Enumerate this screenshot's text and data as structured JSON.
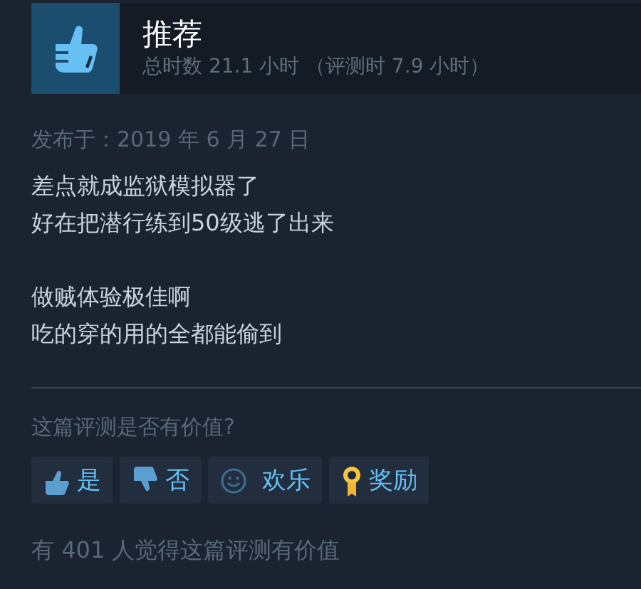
{
  "review": {
    "verdict": "推荐",
    "recommended": true,
    "hours": "总时数 21.1 小时 （评测时 7.9 小时）",
    "posted": "发布于：2019 年 6 月 27 日",
    "paragraphs": [
      [
        "差点就成监狱模拟器了",
        "好在把潜行练到50级逃了出来"
      ],
      [
        "做贼体验极佳啊",
        "吃的穿的用的全都能偷到"
      ]
    ]
  },
  "vote": {
    "question": "这篇评测是否有价值?",
    "buttons": [
      {
        "kind": "yes",
        "label": "是"
      },
      {
        "kind": "no",
        "label": "否"
      },
      {
        "kind": "funny",
        "label": "欢乐"
      },
      {
        "kind": "award",
        "label": "奖励"
      }
    ]
  },
  "helpful": "有 401 人觉得这篇评测有价值"
}
